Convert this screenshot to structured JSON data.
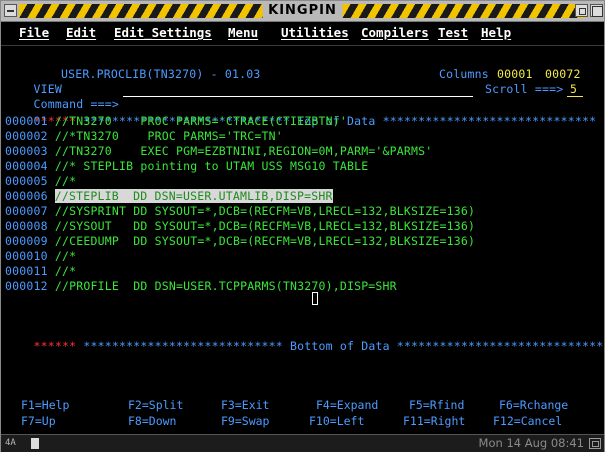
{
  "window": {
    "title": "KINGPIN"
  },
  "menu": [
    "File",
    "Edit",
    "Edit_Settings",
    "Menu",
    "Utilities",
    "Compilers",
    "Test",
    "Help"
  ],
  "editor": {
    "mode": "VIEW",
    "dataset": "USER.PROCLIB(TN3270) - 01.03",
    "columns_label": "Columns",
    "col_from": "00001",
    "col_to": "00072",
    "command_label": "Command ===>",
    "command_value": "",
    "scroll_label": "Scroll ===>",
    "scroll_value": "5",
    "top_line_prefix": "******",
    "top_of_data": " ***************************** Top of Data ******************************",
    "bottom_line_prefix": "******",
    "bottom_of_data": " **************************** Bottom of Data *****************************"
  },
  "lines": [
    {
      "num": "000001",
      "text": " //TN3270    PROC PARMS='CTRACE(CTIEZBTN)'"
    },
    {
      "num": "000002",
      "text": " //*TN3270    PROC PARMS='TRC=TN'"
    },
    {
      "num": "000003",
      "text": " //TN3270    EXEC PGM=EZBTNINI,REGION=0M,PARM='&PARMS'"
    },
    {
      "num": "000004",
      "text": " //* STEPLIB pointing to UTAM USS MSG10 TABLE"
    },
    {
      "num": "000005",
      "text": " //*"
    },
    {
      "num": "000006",
      "text": "//STEPLIB  DD DSN=USER.UTAMLIB,DISP=SHR"
    },
    {
      "num": "000007",
      "text": " //SYSPRINT DD SYSOUT=*,DCB=(RECFM=VB,LRECL=132,BLKSIZE=136)"
    },
    {
      "num": "000008",
      "text": " //SYSOUT   DD SYSOUT=*,DCB=(RECFM=VB,LRECL=132,BLKSIZE=136)"
    },
    {
      "num": "000009",
      "text": " //CEEDUMP  DD SYSOUT=*,DCB=(RECFM=VB,LRECL=132,BLKSIZE=136)"
    },
    {
      "num": "000010",
      "text": " //*"
    },
    {
      "num": "000011",
      "text": " //*"
    },
    {
      "num": "000012",
      "text": " //PROFILE  DD DSN=USER.TCPPARMS(TN3270),DISP=SHR"
    }
  ],
  "pfkeys_row1": [
    "F1=Help",
    "F2=Split",
    "F3=Exit",
    "F4=Expand",
    "F5=Rfind",
    "F6=Rchange"
  ],
  "pfkeys_row2": [
    "F7=Up",
    "F8=Down",
    "F9=Swap",
    "F10=Left",
    "F11=Right",
    "F12=Cancel"
  ],
  "status": {
    "datetime": "Mon 14 Aug 08:41",
    "oia_label": "4A"
  },
  "colors": {
    "blue": "#4d9bff",
    "green": "#39e639",
    "red": "#ff3333",
    "yellow": "#f2e94a",
    "hazard": "#f2c400"
  }
}
